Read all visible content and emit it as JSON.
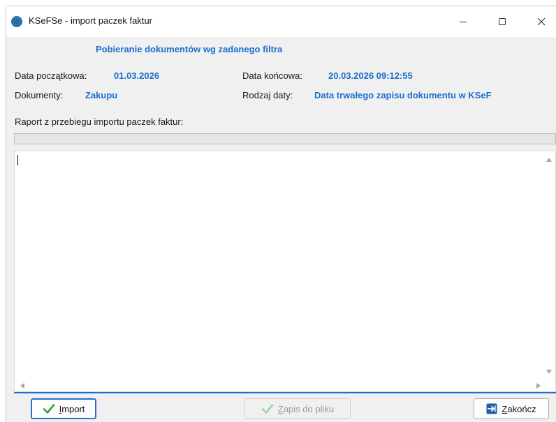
{
  "window": {
    "title": "KSeFSe - import paczek faktur"
  },
  "header": {
    "filter_heading": "Pobieranie dokumentów wg zadanego filtra",
    "start_date_label": "Data początkowa:",
    "start_date_value": "01.03.2026",
    "end_date_label": "Data końcowa:",
    "end_date_value": "20.03.2026 09:12:55",
    "documents_label": "Dokumenty:",
    "documents_value": "Zakupu",
    "date_type_label": "Rodzaj daty:",
    "date_type_value": "Data trwałego zapisu dokumentu w KSeF"
  },
  "report": {
    "label": "Raport z przebiegu importu paczek faktur:",
    "content": "",
    "progress_percent": 0
  },
  "buttons": {
    "import": {
      "first": "I",
      "rest": "mport"
    },
    "save": {
      "first": "Z",
      "rest": "apis do  pliku"
    },
    "close": {
      "first": "Z",
      "rest": "akończ"
    }
  },
  "colors": {
    "accent": "#1a6fcf",
    "check_green": "#2ea043"
  },
  "icons": {
    "app": "ksef-app-icon",
    "minimize": "minimize-icon",
    "maximize": "maximize-icon",
    "close": "close-icon",
    "import": "checkmark-icon",
    "save": "checkmark-icon",
    "exit": "exit-arrow-icon"
  }
}
